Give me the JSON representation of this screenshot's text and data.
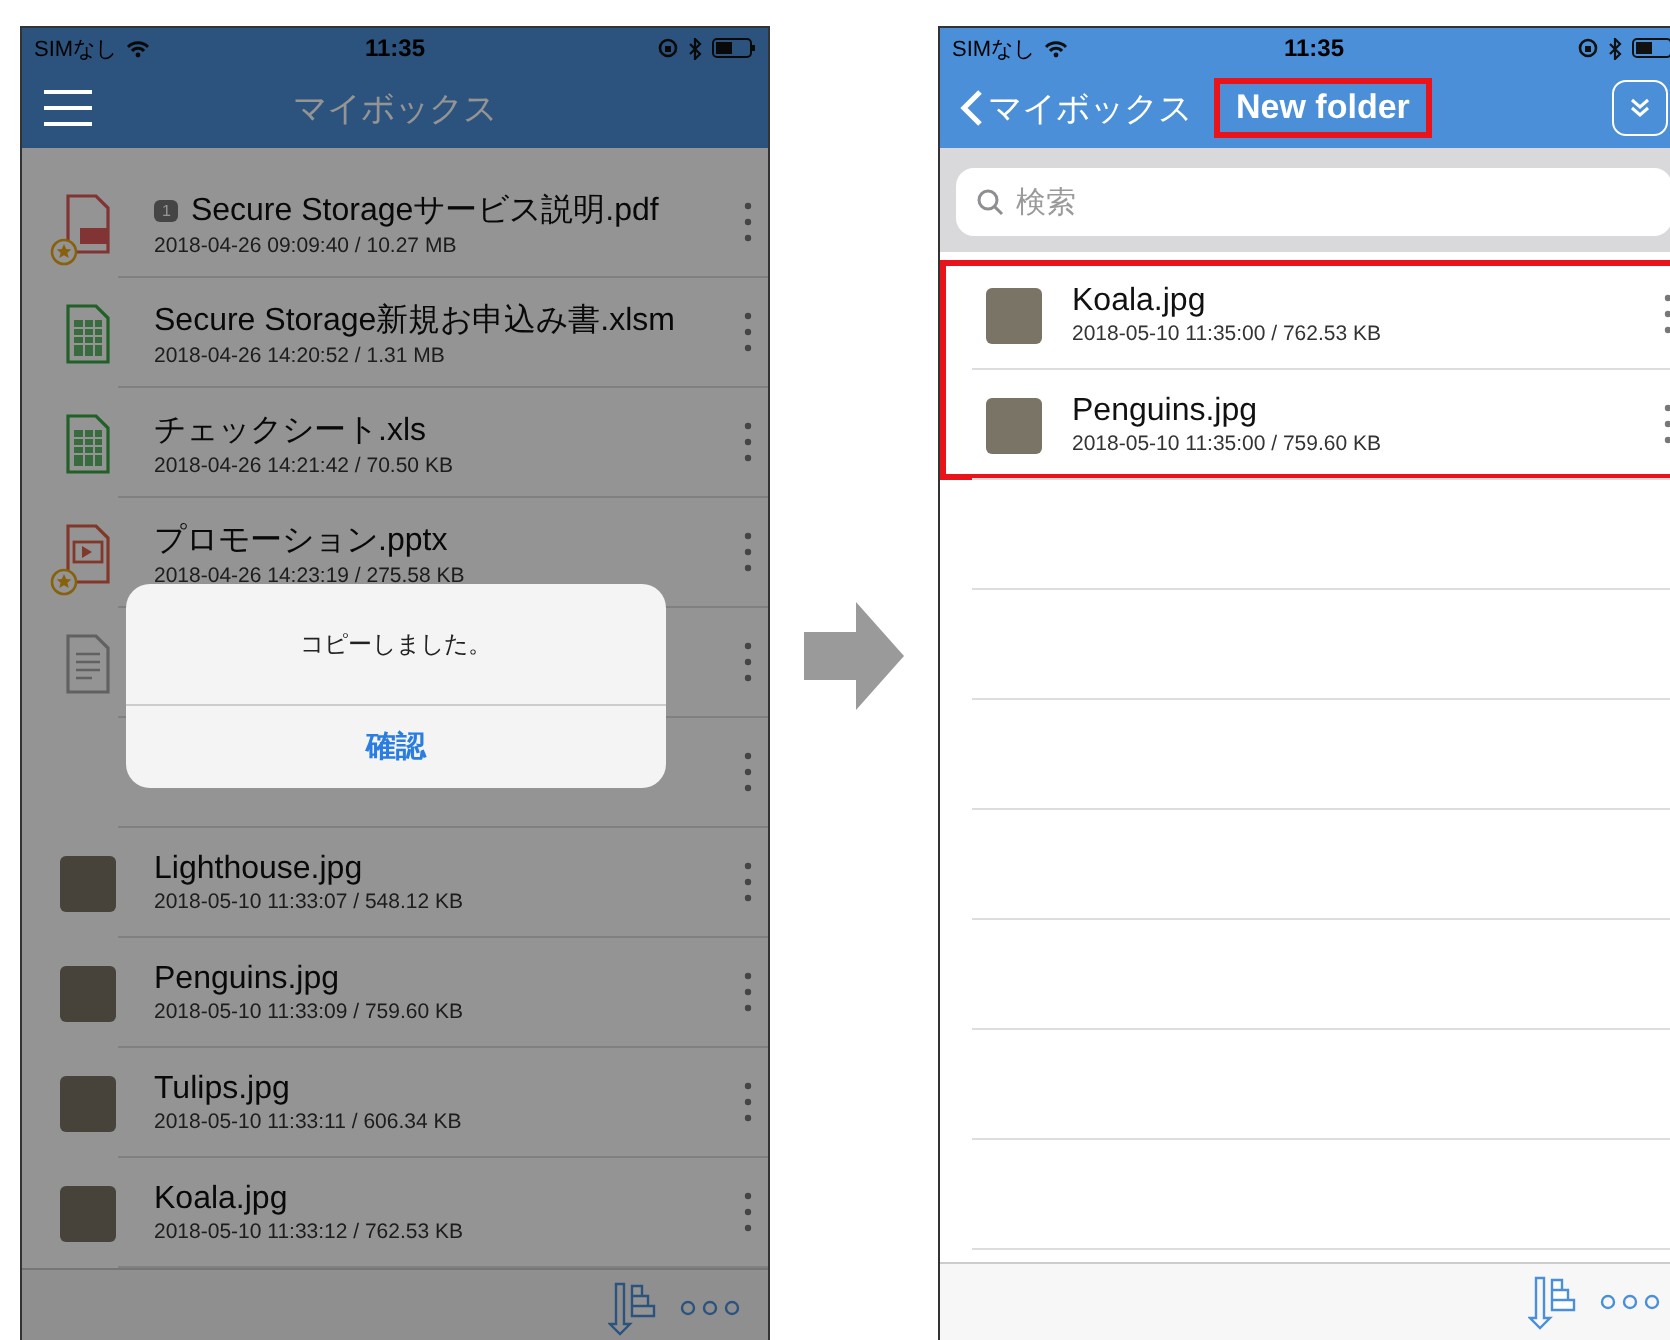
{
  "left": {
    "status_bar": {
      "carrier": "SIMなし",
      "time": "11:35"
    },
    "title": "マイボックス",
    "dimmed": true,
    "files": [
      {
        "kind": "pdf",
        "starred": true,
        "comment_count": "1",
        "name": "Secure Storageサービス説明.pdf",
        "meta": "2018-04-26 09:09:40 / 10.27 MB"
      },
      {
        "kind": "spreadsheet",
        "starred": false,
        "name": "Secure Storage新規お申込み書.xlsm",
        "meta": "2018-04-26 14:20:52 / 1.31 MB"
      },
      {
        "kind": "spreadsheet",
        "starred": false,
        "name": "チェックシート.xls",
        "meta": "2018-04-26 14:21:42 / 70.50 KB"
      },
      {
        "kind": "presentation",
        "starred": true,
        "name": "プロモーション.pptx",
        "meta": "2018-04-26 14:23:19 / 275.58 KB"
      },
      {
        "kind": "document",
        "starred": false
      },
      {
        "kind": "none",
        "starred": false
      },
      {
        "kind": "photo",
        "starred": false,
        "name": "Lighthouse.jpg",
        "meta": "2018-05-10 11:33:07 / 548.12 KB"
      },
      {
        "kind": "photo",
        "starred": false,
        "name": "Penguins.jpg",
        "meta": "2018-05-10 11:33:09 / 759.60 KB"
      },
      {
        "kind": "photo",
        "starred": false,
        "name": "Tulips.jpg",
        "meta": "2018-05-10 11:33:11 / 606.34 KB"
      },
      {
        "kind": "photo",
        "starred": false,
        "name": "Koala.jpg",
        "meta": "2018-05-10 11:33:12 / 762.53 KB"
      }
    ],
    "dialog": {
      "message": "コピーしました。",
      "button": "確認"
    }
  },
  "right": {
    "status_bar": {
      "carrier": "SIMなし",
      "time": "11:35"
    },
    "back_label": "マイボックス",
    "title": "New folder",
    "title_highlighted": true,
    "search": {
      "placeholder": "検索"
    },
    "files_highlighted": true,
    "files": [
      {
        "kind": "photo",
        "starred": false,
        "name": "Koala.jpg",
        "meta": "2018-05-10 11:35:00 / 762.53 KB"
      },
      {
        "kind": "photo",
        "starred": false,
        "name": "Penguins.jpg",
        "meta": "2018-05-10 11:35:00 / 759.60 KB"
      }
    ]
  }
}
